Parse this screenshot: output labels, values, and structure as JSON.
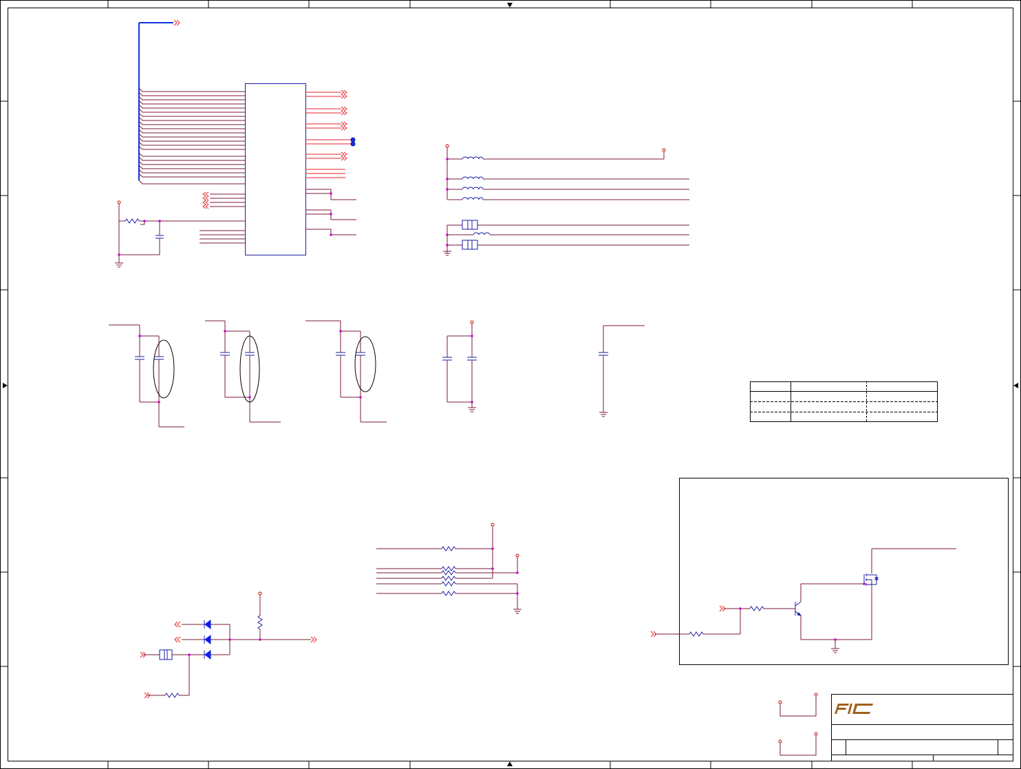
{
  "sheet": {
    "background": "#ffffff",
    "frame_color": "#000000"
  },
  "colors": {
    "wire": "#7a1a3a",
    "signal": "#e8202a",
    "bus": "#1030e0",
    "component": "#1a1aa0",
    "junction": "#cc00cc",
    "diode": "#1020e0",
    "logo": "#a0601a"
  },
  "title_block": {
    "logo_name": "FIC-logo"
  }
}
